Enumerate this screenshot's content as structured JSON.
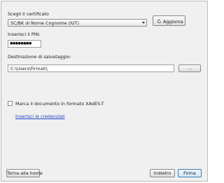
{
  "certificate": {
    "label": "Scegli il certificato",
    "selected": "SC/BK di Nome Cognome (IUT)"
  },
  "refresh_button": {
    "label": "Aggiorna",
    "icon": "refresh-icon"
  },
  "pin": {
    "label": "Inserisci il PIN:",
    "value": "●●●●●●●●"
  },
  "destination": {
    "label": "Destinazione di salvataggio:",
    "path": "C:\\Users\\Firmati\\",
    "browse_label": "..."
  },
  "timestamp": {
    "label": "Marca il documento in formato XAdES-T",
    "checked": false
  },
  "credentials_link": "Inserisci le credenziali",
  "footer": {
    "home_label": "Torna alla home",
    "back_label": "Indietro",
    "sign_label": "Firma"
  }
}
